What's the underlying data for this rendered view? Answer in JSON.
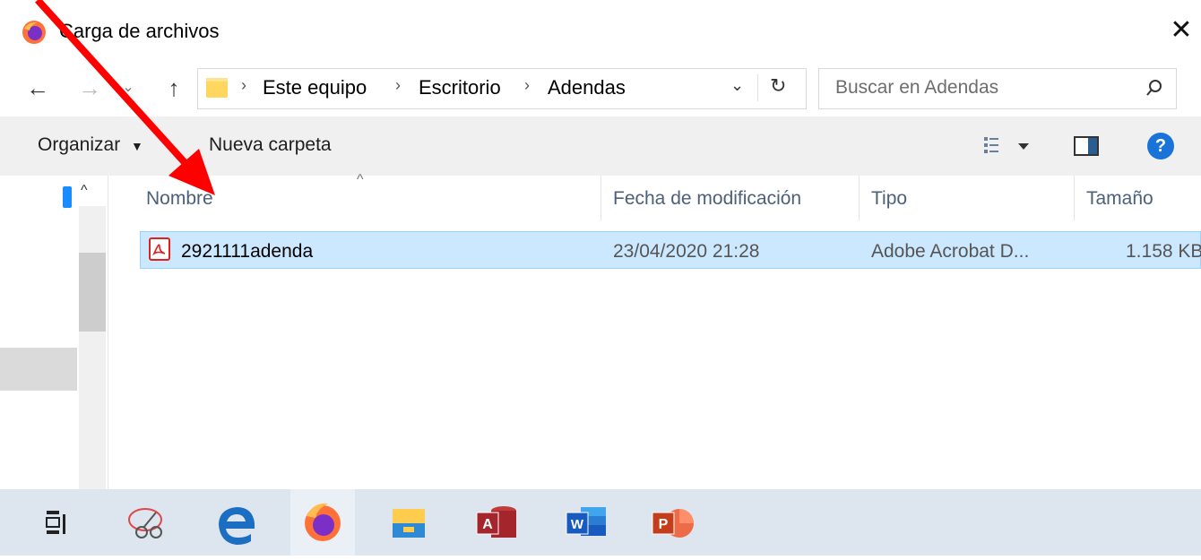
{
  "window": {
    "title": "Carga de archivos",
    "close_icon": "close-icon"
  },
  "address": {
    "crumbs": [
      "Este equipo",
      "Escritorio",
      "Adendas"
    ],
    "search_placeholder": "Buscar en Adendas"
  },
  "toolbar": {
    "organize_label": "Organizar",
    "new_folder_label": "Nueva carpeta",
    "help_glyph": "?"
  },
  "columns": {
    "name": "Nombre",
    "modified": "Fecha de modificación",
    "type": "Tipo",
    "size": "Tamaño"
  },
  "files": [
    {
      "name": "2921111adenda",
      "modified": "23/04/2020 21:28",
      "type": "Adobe Acrobat D...",
      "size": "1.158 KB",
      "icon": "pdf-file-icon"
    }
  ],
  "taskbar": {
    "items": [
      "task-view-icon",
      "snipping-tool-icon",
      "edge-icon",
      "firefox-icon",
      "file-explorer-icon",
      "access-icon",
      "word-icon",
      "powerpoint-icon"
    ]
  },
  "colors": {
    "selection": "#cce8ff",
    "selection_border": "#99d1ff",
    "annotation_arrow": "#ff0000",
    "help": "#1a73d9"
  }
}
